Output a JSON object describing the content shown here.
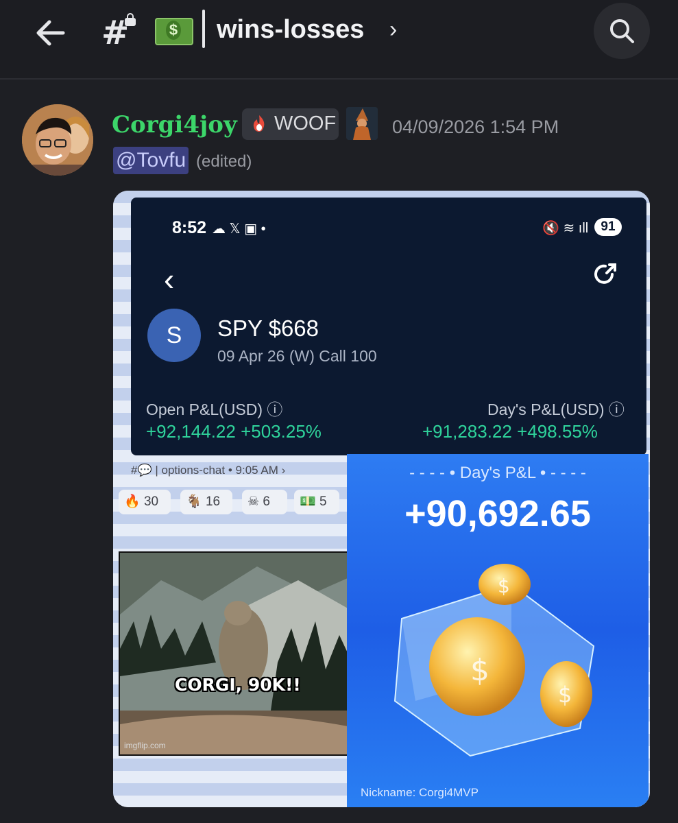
{
  "header": {
    "channel_name": "wins-losses"
  },
  "message": {
    "username": "Corgi4joy",
    "role_tag": "WOOF",
    "timestamp": "04/09/2026 1:54 PM",
    "mention": "@Tovfu",
    "edited_label": "(edited)"
  },
  "attachment": {
    "phone": {
      "time": "8:52",
      "status_icons": "☁ 𝕏 ▣ •",
      "battery": "91",
      "avatar_letter": "S",
      "ticker": "SPY $668",
      "contract": "09 Apr 26 (W) Call 100",
      "open_pl_label": "Open P&L(USD) ⓘ",
      "day_pl_label": "Day's P&L(USD) ⓘ",
      "open_pl_value": "+92,144.22 +503.25%",
      "day_pl_value": "+91,283.22 +498.55%"
    },
    "chat_context": {
      "channel": "options-chat",
      "time": "9:05 AM",
      "reactions": [
        {
          "emoji": "🔥",
          "count": "30"
        },
        {
          "emoji": "🐐",
          "count": "16"
        },
        {
          "emoji": "☠",
          "count": "6"
        },
        {
          "emoji": "💵",
          "count": "5"
        }
      ]
    },
    "meme": {
      "caption": "CORGI, 90K!!",
      "watermark": "imgflip.com"
    },
    "card": {
      "title": "Day's P&L",
      "amount": "+90,692.65",
      "nickname": "Nickname: Corgi4MVP"
    }
  },
  "colors": {
    "username": "#3cd66a",
    "profit_green": "#2fd39b",
    "card_blue": "#2e7cf2"
  }
}
